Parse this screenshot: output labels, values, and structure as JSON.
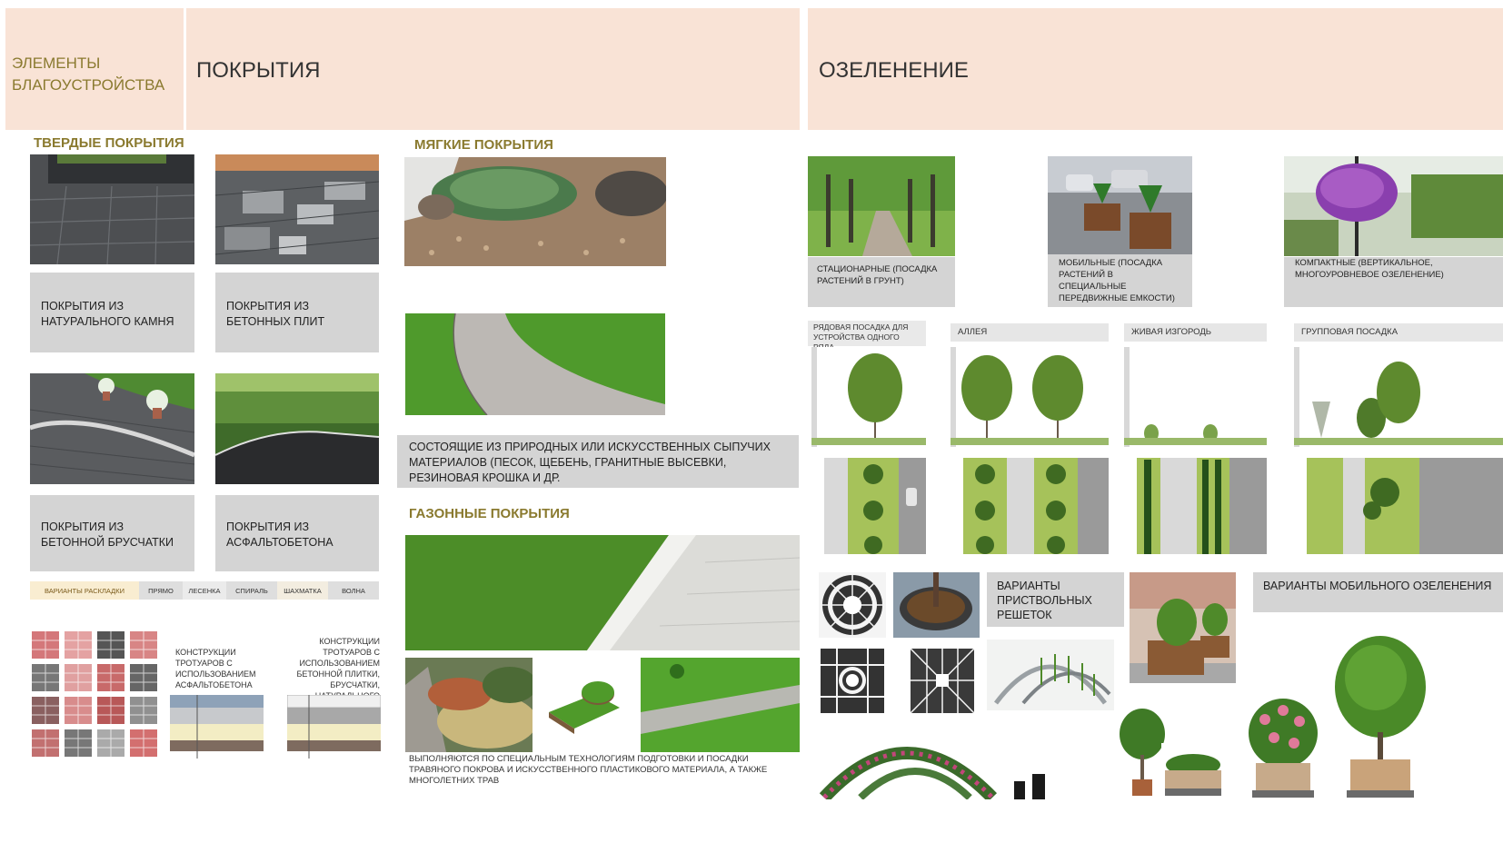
{
  "header": {
    "elements_title": "ЭЛЕМЕНТЫ БЛАГОУСТРОЙСТВА",
    "coverings_title": "ПОКРЫТИЯ",
    "greening_title": "ОЗЕЛЕНЕНИЕ"
  },
  "hard": {
    "label": "ТВЕРДЫЕ ПОКРЫТИЯ",
    "natural_stone": "ПОКРЫТИЯ ИЗ НАТУРАЛЬНОГО КАМНЯ",
    "concrete_slabs": "ПОКРЫТИЯ ИЗ БЕТОННЫХ ПЛИТ",
    "paving_blocks": "ПОКРЫТИЯ ИЗ БЕТОННОЙ БРУСЧАТКИ",
    "asphalt": "ПОКРЫТИЯ ИЗ АСФАЛЬТОБЕТОНА",
    "layouts": {
      "label": "ВАРИАНТЫ РАСКЛАДКИ",
      "items": [
        "ПРЯМО",
        "ЛЕСЕНКА",
        "СПИРАЛЬ",
        "ШАХМАТКА",
        "ВОЛНА"
      ]
    },
    "construction_asphalt": "КОНСТРУКЦИИ ТРОТУАРОВ С ИСПОЛЬЗОВАНИЕМ АСФАЛЬТОБЕТОНА",
    "construction_tiles": "КОНСТРУКЦИИ ТРОТУАРОВ С ИСПОЛЬЗОВАНИЕМ БЕТОННОЙ ПЛИТКИ, БРУСЧАТКИ, НАТУРАЛЬНОГО КАМНЯ"
  },
  "soft": {
    "label": "МЯГКИЕ ПОКРЫТИЯ",
    "description": "СОСТОЯЩИЕ ИЗ ПРИРОДНЫХ ИЛИ ИСКУССТВЕННЫХ СЫПУЧИХ МАТЕРИАЛОВ (ПЕСОК, ЩЕБЕНЬ, ГРАНИТНЫЕ ВЫСЕВКИ, РЕЗИНОВАЯ КРОШКА И ДР."
  },
  "lawn": {
    "label": "ГАЗОННЫЕ ПОКРЫТИЯ",
    "description": "ВЫПОЛНЯЮТСЯ ПО СПЕЦИАЛЬНЫМ ТЕХНОЛОГИЯМ ПОДГОТОВКИ И ПОСАДКИ ТРАВЯНОГО ПОКРОВА И ИСКУССТВЕННОГО ПЛАСТИКОВОГО МАТЕРИАЛА, А ТАКЖЕ МНОГОЛЕТНИХ ТРАВ"
  },
  "greening": {
    "stationary": "СТАЦИОНАРНЫЕ (ПОСАДКА РАСТЕНИЙ В ГРУНТ)",
    "mobile": "МОБИЛЬНЫЕ (ПОСАДКА РАСТЕНИЙ В СПЕЦИАЛЬНЫЕ ПЕРЕДВИЖНЫЕ ЕМКОСТИ)",
    "compact": "КОМПАКТНЫЕ (ВЕРТИКАЛЬНОЕ, МНОГОУРОВНЕВОЕ ОЗЕЛЕНЕНИЕ)",
    "sections": [
      "РЯДОВАЯ ПОСАДКА ДЛЯ УСТРОЙСТВА ОДНОГО РЯДА",
      "АЛЛЕЯ",
      "ЖИВАЯ ИЗГОРОДЬ",
      "ГРУППОВАЯ ПОСАДКА"
    ],
    "tree_grates": "ВАРИАНТЫ ПРИСТВОЛЬНЫХ РЕШЕТОК",
    "mobile_variants": "ВАРИАНТЫ МОБИЛЬНОГО ОЗЕЛЕНЕНИЯ"
  },
  "colors": {
    "header_bg": "#f9e3d6",
    "label_olive": "#8a7a2f",
    "box_gray": "#d4d4d4",
    "grass": "#5e9b2e"
  }
}
